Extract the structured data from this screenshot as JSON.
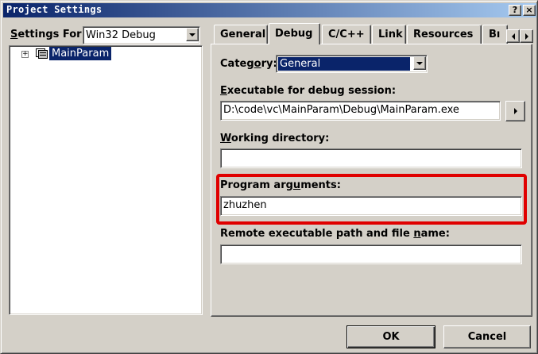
{
  "window": {
    "title": "Project Settings",
    "help_glyph": "?",
    "close_glyph": "×"
  },
  "left": {
    "settings_for_label_accel": "S",
    "settings_for_label_rest": "ettings For:",
    "settings_for_value": "Win32 Debug",
    "tree": {
      "expander": "+",
      "root_item": "MainParam"
    }
  },
  "tabs": {
    "items": [
      "General",
      "Debug",
      "C/C++",
      "Link",
      "Resources",
      "Bı"
    ],
    "active": "Debug"
  },
  "debug": {
    "category_label_pre": "Categ",
    "category_label_accel": "o",
    "category_label_post": "ry:",
    "category_value": "General",
    "exe_label_accel": "E",
    "exe_label_rest": "xecutable for debug session:",
    "exe_value": "D:\\code\\vc\\MainParam\\Debug\\MainParam.exe",
    "workdir_label_accel": "W",
    "workdir_label_rest": "orking directory:",
    "workdir_value": "",
    "args_label_pre": "Program arg",
    "args_label_accel": "u",
    "args_label_post": "ments:",
    "args_value": "zhuzhen",
    "remote_label_pre": "Remote executable path and file ",
    "remote_label_accel": "n",
    "remote_label_post": "ame:",
    "remote_value": ""
  },
  "buttons": {
    "ok": "OK",
    "cancel": "Cancel"
  },
  "colors": {
    "highlight": "#cc0000",
    "selection": "#0a246a",
    "titlebar": "#0a246a"
  }
}
